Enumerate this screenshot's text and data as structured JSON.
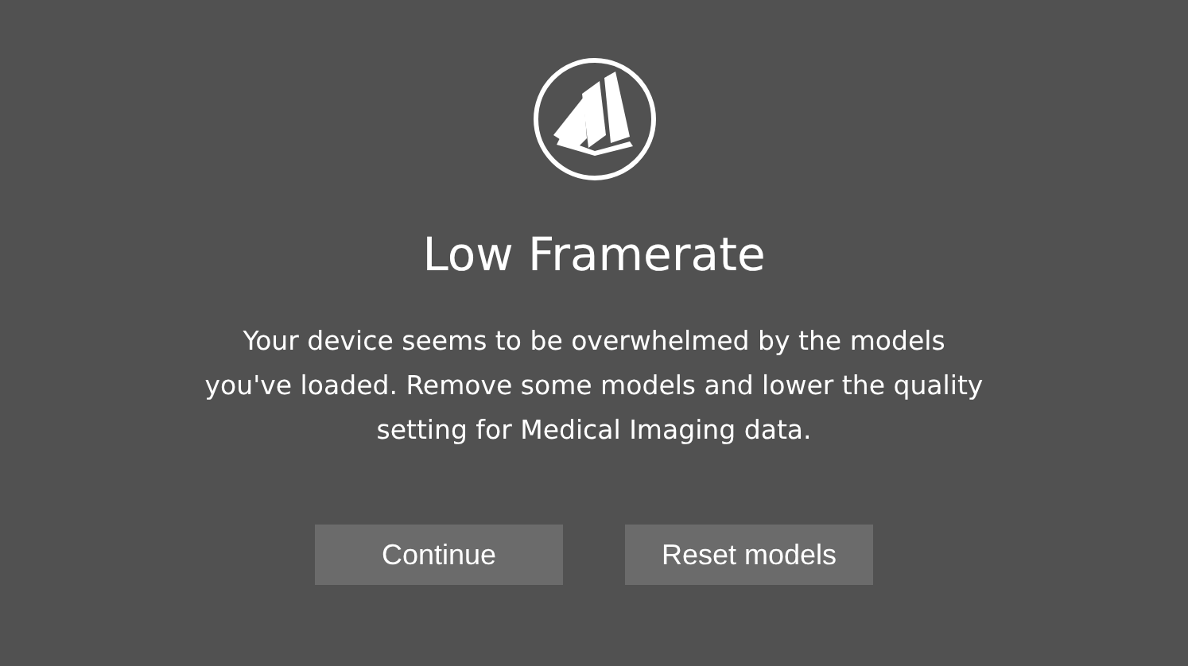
{
  "dialog": {
    "title": "Low Framerate",
    "message": "Your device seems to be overwhelmed by the models you've loaded. Remove some models and lower the quality setting for Medical Imaging data.",
    "buttons": [
      "Continue",
      "Reset models"
    ]
  }
}
